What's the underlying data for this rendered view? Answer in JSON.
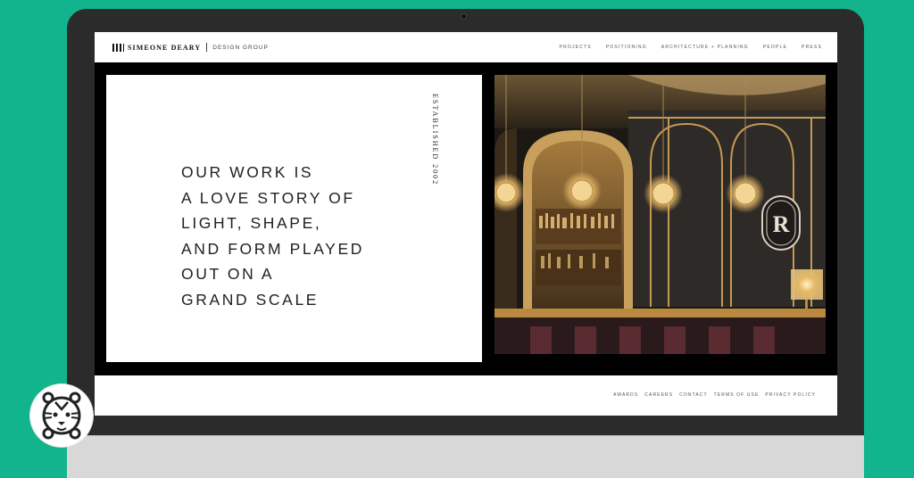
{
  "header": {
    "brand_name": "SIMEONE DEARY",
    "brand_sub": "DESIGN GROUP",
    "nav": [
      "PROJECTS",
      "POSITIONING",
      "ARCHITECTURE + PLANNING",
      "PEOPLE",
      "PRESS"
    ]
  },
  "hero": {
    "tagline": "OUR WORK IS\nA LOVE STORY OF\nLIGHT, SHAPE,\nAND FORM PLAYED\nOUT ON A\nGRAND SCALE",
    "established": "ESTABLISHED 2002",
    "photo_logo": "R"
  },
  "footer": {
    "links": [
      "AWARDS",
      "CAREERS",
      "CONTACT",
      "TERMS OF USE",
      "PRIVACY POLICY"
    ]
  },
  "colors": {
    "background": "#12b48e",
    "monitor_bezel": "#2b2b2b",
    "gold": "#d6a45a"
  },
  "icons": {
    "badge": "tiger-icon",
    "brand": "building-icon"
  }
}
